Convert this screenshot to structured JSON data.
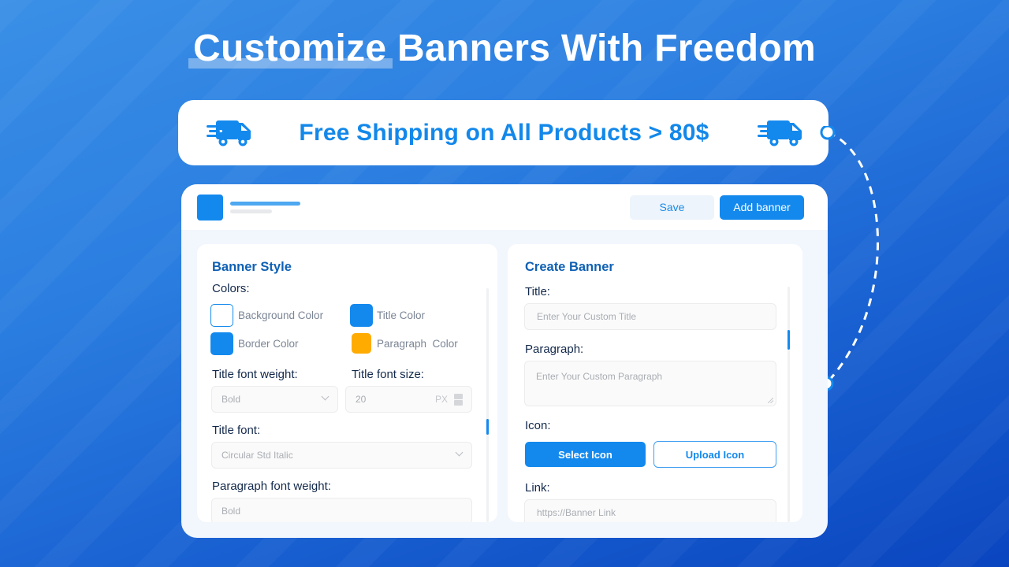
{
  "headline": {
    "highlighted": "Customize",
    "rest": " Banners With Freedom"
  },
  "promo_banner": {
    "text": "Free Shipping on All Products > 80$",
    "left_icon": "delivery-truck-icon",
    "right_icon": "delivery-truck-icon"
  },
  "app": {
    "header": {
      "save_label": "Save",
      "add_banner_label": "Add banner"
    },
    "banner_style": {
      "title": "Banner Style",
      "colors_label": "Colors:",
      "colors": [
        {
          "label": "Background Color",
          "color": "#ffffff"
        },
        {
          "label": "Title Color",
          "color": "#1389ee"
        },
        {
          "label": "Border Color",
          "color": "#1389ee"
        },
        {
          "label": "Paragraph  Color",
          "color": "#ffab00"
        }
      ],
      "title_font_weight_label": "Title font weight:",
      "title_font_weight_value": "Bold",
      "title_font_size_label": "Title font size:",
      "title_font_size_value": "20",
      "title_font_size_unit": "PX",
      "title_font_label": "Title font:",
      "title_font_value": "Circular Std Italic",
      "paragraph_font_weight_label": "Paragraph font weight:",
      "paragraph_font_weight_value": "Bold"
    },
    "create_banner": {
      "title": "Create Banner",
      "title_label": "Title:",
      "title_placeholder": "Enter Your Custom Title",
      "paragraph_label": "Paragraph:",
      "paragraph_placeholder": "Enter Your Custom Paragraph",
      "icon_label": "Icon:",
      "select_icon_label": "Select Icon",
      "upload_icon_label": "Upload Icon",
      "link_label": "Link:",
      "link_placeholder": "https://Banner Link"
    }
  },
  "colors": {
    "accent": "#1389ee",
    "heading": "#0f61b4",
    "label": "#13294b"
  }
}
